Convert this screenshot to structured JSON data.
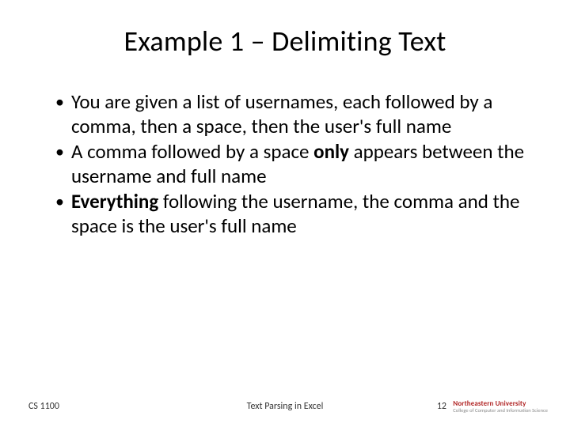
{
  "title": "Example 1 – Delimiting Text",
  "bullets": [
    {
      "pre": "You are given a list of usernames, each followed by a comma, then a space, then the user's full name",
      "bold": "",
      "post": ""
    },
    {
      "pre": "A comma followed by a space ",
      "bold": "only",
      "post": " appears between the username and full name"
    },
    {
      "pre": "",
      "bold": "Everything",
      "post": " following the username, the comma and the space is the user's full name"
    }
  ],
  "footer": {
    "left": "CS 1100",
    "center": "Text Parsing in Excel",
    "page": "12",
    "logo_line1": "Northeastern University",
    "logo_line2": "College of Computer and Information Science"
  }
}
